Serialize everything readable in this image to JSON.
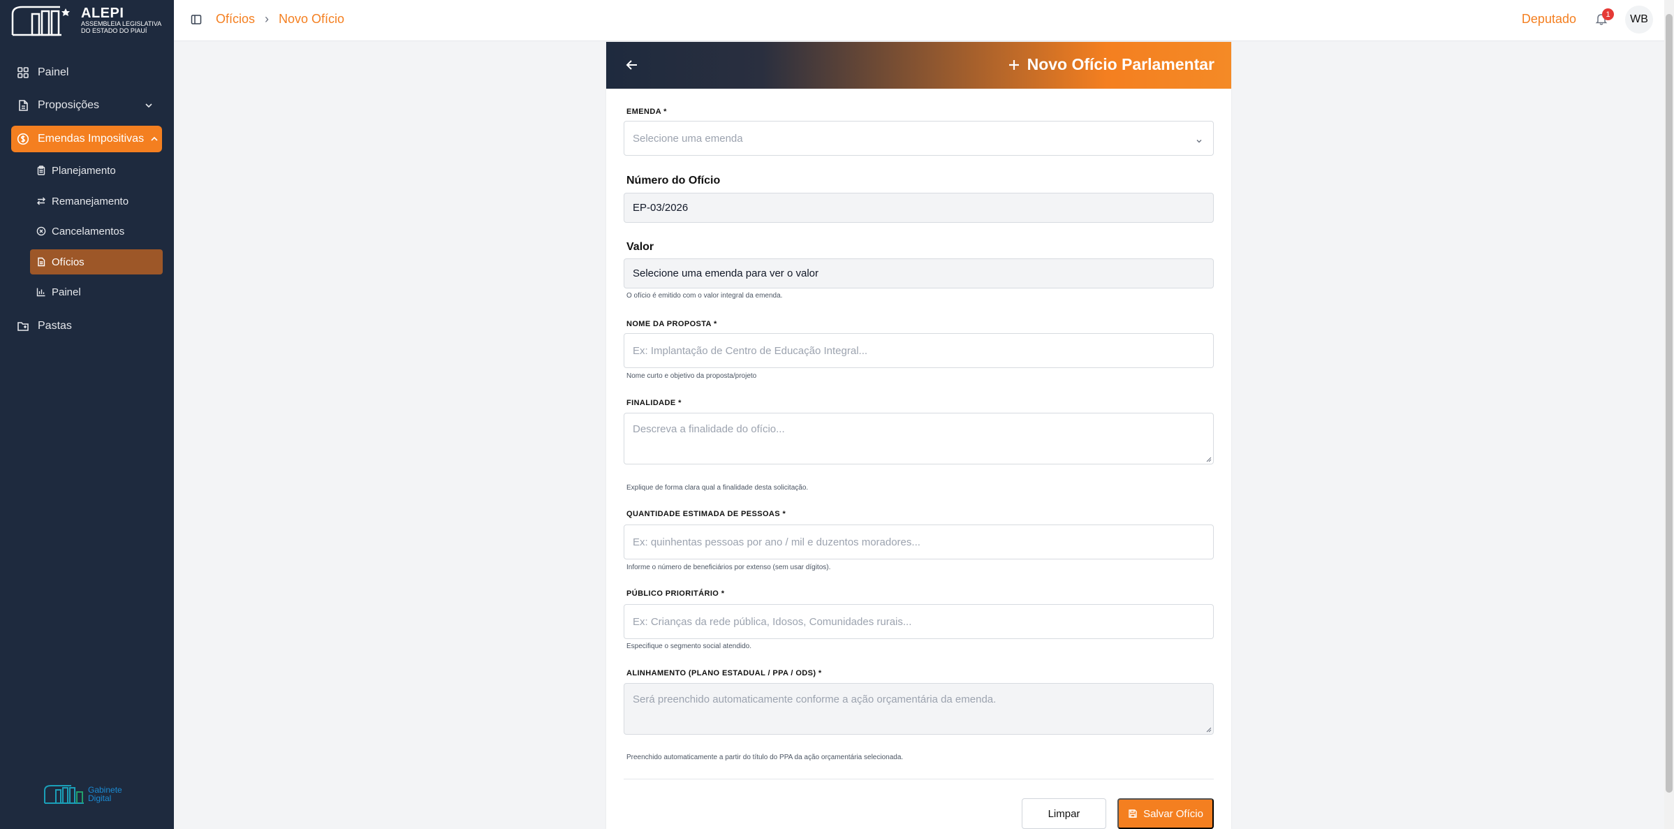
{
  "brand": {
    "name": "ALEPI",
    "subtitle_line1": "ASSEMBLEIA LEGISLATIVA",
    "subtitle_line2": "DO ESTADO DO PIAUÍ",
    "footer_line1": "Gabinete",
    "footer_line2": "Digital"
  },
  "sidebar": {
    "items": [
      {
        "label": "Painel",
        "icon": "grid-icon"
      },
      {
        "label": "Proposições",
        "icon": "document-icon"
      },
      {
        "label": "Emendas Impositivas",
        "icon": "dollar-circle-icon",
        "active": true
      },
      {
        "label": "Pastas",
        "icon": "folder-icon"
      }
    ],
    "subitems": [
      {
        "label": "Planejamento",
        "icon": "clipboard-icon"
      },
      {
        "label": "Remanejamento",
        "icon": "arrows-swap-icon"
      },
      {
        "label": "Cancelamentos",
        "icon": "x-circle-icon"
      },
      {
        "label": "Ofícios",
        "icon": "file-icon",
        "active": true
      },
      {
        "label": "Painel",
        "icon": "bar-chart-icon"
      }
    ]
  },
  "header": {
    "breadcrumb": [
      "Ofícios",
      "Novo Ofício"
    ],
    "role": "Deputado",
    "notifications": "1",
    "avatar": "WB"
  },
  "form": {
    "title": "Novo Ofício Parlamentar",
    "emenda": {
      "label": "EMENDA *",
      "placeholder": "Selecione uma emenda"
    },
    "numero": {
      "label": "Número do Ofício",
      "value": "EP-03/2026"
    },
    "valor": {
      "label": "Valor",
      "value": "Selecione uma emenda para ver o valor",
      "hint": "O ofício é emitido com o valor integral da emenda."
    },
    "nome": {
      "label": "NOME DA PROPOSTA *",
      "placeholder": "Ex: Implantação de Centro de Educação Integral...",
      "hint": "Nome curto e objetivo da proposta/projeto"
    },
    "finalidade": {
      "label": "FINALIDADE *",
      "placeholder": "Descreva a finalidade do ofício...",
      "hint": "Explique de forma clara qual a finalidade desta solicitação."
    },
    "quantidade": {
      "label": "QUANTIDADE ESTIMADA DE PESSOAS *",
      "placeholder": "Ex: quinhentas pessoas por ano / mil e duzentos moradores...",
      "hint": "Informe o número de beneficiários por extenso (sem usar dígitos)."
    },
    "publico": {
      "label": "PÚBLICO PRIORITÁRIO *",
      "placeholder": "Ex: Crianças da rede pública, Idosos, Comunidades rurais...",
      "hint": "Especifique o segmento social atendido."
    },
    "alinhamento": {
      "label": "ALINHAMENTO (PLANO ESTADUAL / PPA / ODS) *",
      "placeholder": "Será preenchido automaticamente conforme a ação orçamentária da emenda.",
      "hint": "Preenchido automaticamente a partir do título do PPA da ação orçamentária selecionada."
    },
    "clear_label": "Limpar",
    "save_label": "Salvar Ofício"
  },
  "colors": {
    "accent": "#f47f20",
    "sidebar": "#1e2a3e",
    "active_sub": "#9d5728"
  }
}
